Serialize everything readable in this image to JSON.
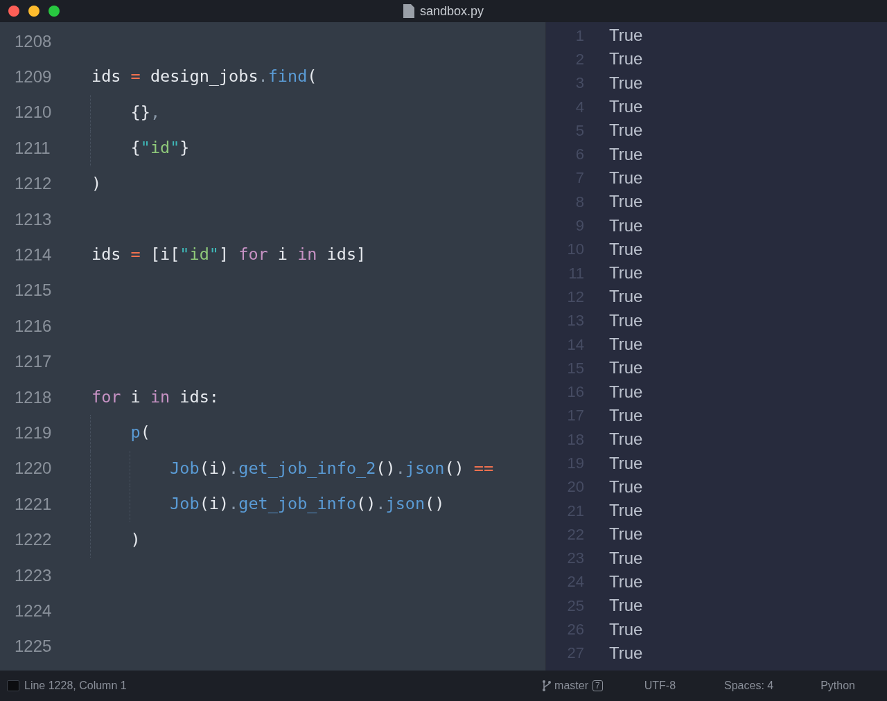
{
  "window": {
    "title": "sandbox.py"
  },
  "editor": {
    "lines": [
      {
        "number": "1208"
      },
      {
        "number": "1209",
        "tokens": [
          {
            "kind": "plain",
            "text": "ids "
          },
          {
            "kind": "op",
            "text": "="
          },
          {
            "kind": "plain",
            "text": " design_jobs"
          },
          {
            "kind": "punct",
            "text": "."
          },
          {
            "kind": "func",
            "text": "find"
          },
          {
            "kind": "plain",
            "text": "("
          }
        ]
      },
      {
        "number": "1210",
        "tokens": [
          {
            "kind": "plain",
            "text": "    {}"
          },
          {
            "kind": "punct",
            "text": ","
          }
        ]
      },
      {
        "number": "1211",
        "tokens": [
          {
            "kind": "plain",
            "text": "    {"
          },
          {
            "kind": "quote",
            "text": "\""
          },
          {
            "kind": "str",
            "text": "id"
          },
          {
            "kind": "quote",
            "text": "\""
          },
          {
            "kind": "plain",
            "text": "}"
          }
        ]
      },
      {
        "number": "1212",
        "tokens": [
          {
            "kind": "plain",
            "text": ")"
          }
        ]
      },
      {
        "number": "1213"
      },
      {
        "number": "1214",
        "tokens": [
          {
            "kind": "plain",
            "text": "ids "
          },
          {
            "kind": "op",
            "text": "="
          },
          {
            "kind": "plain",
            "text": " [i["
          },
          {
            "kind": "quote",
            "text": "\""
          },
          {
            "kind": "str",
            "text": "id"
          },
          {
            "kind": "quote",
            "text": "\""
          },
          {
            "kind": "plain",
            "text": "] "
          },
          {
            "kind": "keyword",
            "text": "for"
          },
          {
            "kind": "plain",
            "text": " i "
          },
          {
            "kind": "keyword",
            "text": "in"
          },
          {
            "kind": "plain",
            "text": " ids]"
          }
        ]
      },
      {
        "number": "1215"
      },
      {
        "number": "1216"
      },
      {
        "number": "1217"
      },
      {
        "number": "1218",
        "tokens": [
          {
            "kind": "keyword",
            "text": "for"
          },
          {
            "kind": "plain",
            "text": " i "
          },
          {
            "kind": "keyword",
            "text": "in"
          },
          {
            "kind": "plain",
            "text": " ids:"
          }
        ]
      },
      {
        "number": "1219",
        "tokens": [
          {
            "kind": "func",
            "text": "    p"
          },
          {
            "kind": "plain",
            "text": "("
          }
        ]
      },
      {
        "number": "1220",
        "tokens": [
          {
            "kind": "func",
            "text": "        Job"
          },
          {
            "kind": "plain",
            "text": "(i)"
          },
          {
            "kind": "punct",
            "text": "."
          },
          {
            "kind": "func",
            "text": "get_job_info_2"
          },
          {
            "kind": "plain",
            "text": "()"
          },
          {
            "kind": "punct",
            "text": "."
          },
          {
            "kind": "func",
            "text": "json"
          },
          {
            "kind": "plain",
            "text": "() "
          },
          {
            "kind": "op",
            "text": "=="
          }
        ]
      },
      {
        "number": "1221",
        "tokens": [
          {
            "kind": "func",
            "text": "        Job"
          },
          {
            "kind": "plain",
            "text": "(i)"
          },
          {
            "kind": "punct",
            "text": "."
          },
          {
            "kind": "func",
            "text": "get_job_info"
          },
          {
            "kind": "plain",
            "text": "()"
          },
          {
            "kind": "punct",
            "text": "."
          },
          {
            "kind": "func",
            "text": "json"
          },
          {
            "kind": "plain",
            "text": "()"
          }
        ]
      },
      {
        "number": "1222",
        "tokens": [
          {
            "kind": "plain",
            "text": "    )"
          }
        ]
      },
      {
        "number": "1223"
      },
      {
        "number": "1224"
      },
      {
        "number": "1225"
      }
    ]
  },
  "output": {
    "lines": [
      {
        "number": "1",
        "text": "True"
      },
      {
        "number": "2",
        "text": "True"
      },
      {
        "number": "3",
        "text": "True"
      },
      {
        "number": "4",
        "text": "True"
      },
      {
        "number": "5",
        "text": "True"
      },
      {
        "number": "6",
        "text": "True"
      },
      {
        "number": "7",
        "text": "True"
      },
      {
        "number": "8",
        "text": "True"
      },
      {
        "number": "9",
        "text": "True"
      },
      {
        "number": "10",
        "text": "True"
      },
      {
        "number": "11",
        "text": "True"
      },
      {
        "number": "12",
        "text": "True"
      },
      {
        "number": "13",
        "text": "True"
      },
      {
        "number": "14",
        "text": "True"
      },
      {
        "number": "15",
        "text": "True"
      },
      {
        "number": "16",
        "text": "True"
      },
      {
        "number": "17",
        "text": "True"
      },
      {
        "number": "18",
        "text": "True"
      },
      {
        "number": "19",
        "text": "True"
      },
      {
        "number": "20",
        "text": "True"
      },
      {
        "number": "21",
        "text": "True"
      },
      {
        "number": "22",
        "text": "True"
      },
      {
        "number": "23",
        "text": "True"
      },
      {
        "number": "24",
        "text": "True"
      },
      {
        "number": "25",
        "text": "True"
      },
      {
        "number": "26",
        "text": "True"
      },
      {
        "number": "27",
        "text": "True"
      }
    ]
  },
  "status_bar": {
    "position": "Line 1228, Column 1",
    "branch": "master",
    "badge": "7",
    "encoding": "UTF-8",
    "indentation": "Spaces: 4",
    "syntax": "Python"
  }
}
